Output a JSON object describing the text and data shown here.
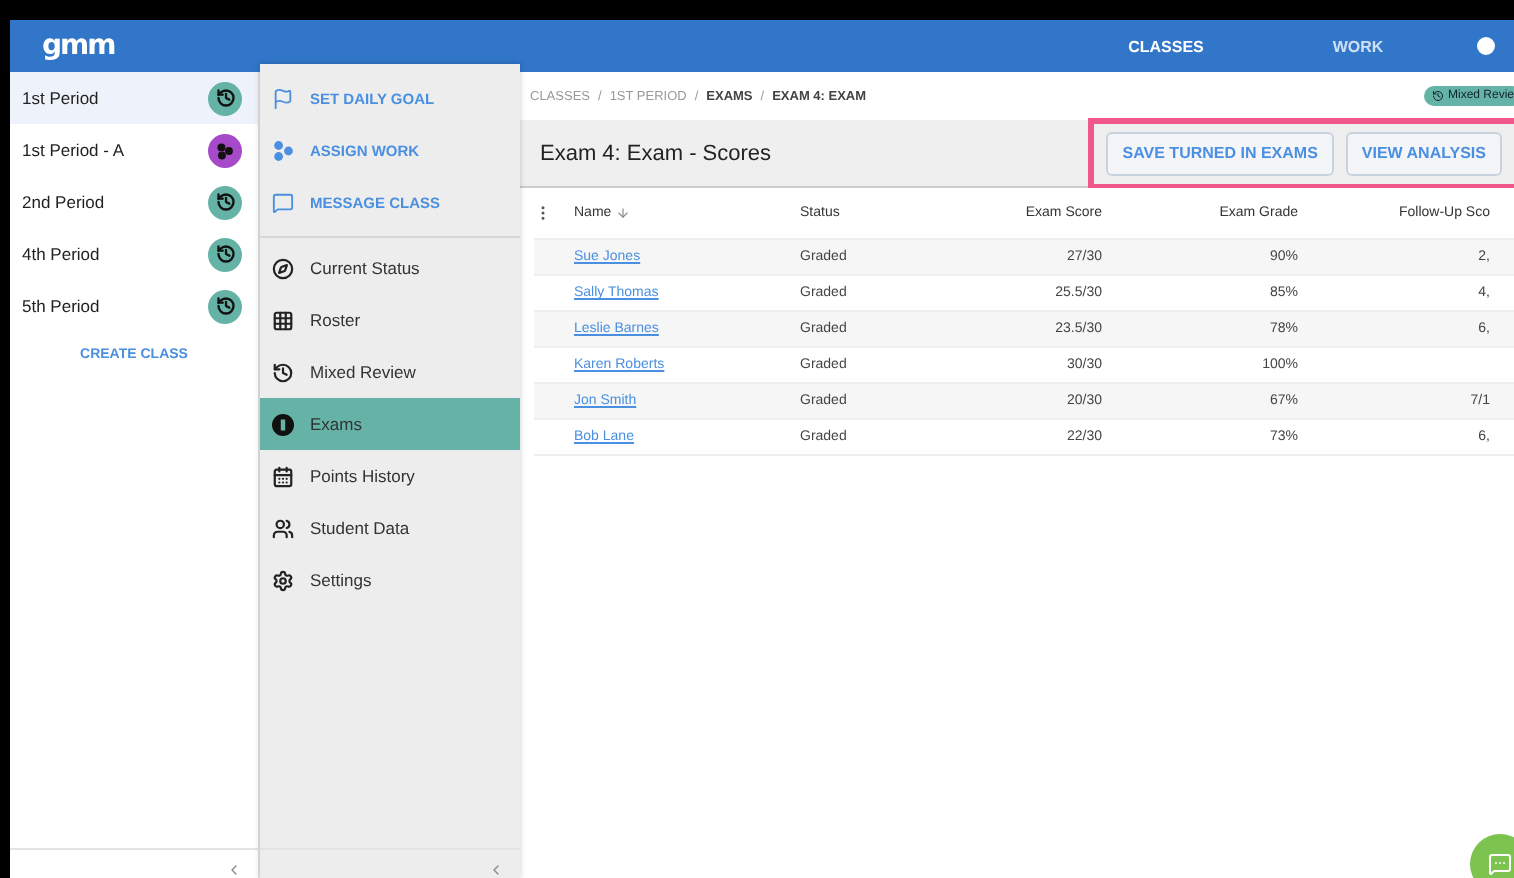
{
  "topbar": {
    "logo": "gmm",
    "nav": [
      {
        "label": "CLASSES",
        "selected": true
      },
      {
        "label": "WORK",
        "selected": false
      }
    ]
  },
  "classes": [
    {
      "name": "1st Period",
      "selected": true,
      "kind": "history"
    },
    {
      "name": "1st Period - A",
      "selected": false,
      "kind": "dots"
    },
    {
      "name": "2nd Period",
      "selected": false,
      "kind": "history"
    },
    {
      "name": "4th Period",
      "selected": false,
      "kind": "history"
    },
    {
      "name": "5th Period",
      "selected": false,
      "kind": "history"
    }
  ],
  "create_class": "CREATE CLASS",
  "class_actions": [
    {
      "label": "SET DAILY GOAL",
      "kind": "flag"
    },
    {
      "label": "ASSIGN WORK",
      "kind": "assign"
    },
    {
      "label": "MESSAGE CLASS",
      "kind": "message"
    }
  ],
  "class_nav": [
    {
      "label": "Current Status",
      "kind": "compass",
      "selected": false
    },
    {
      "label": "Roster",
      "kind": "grid",
      "selected": false
    },
    {
      "label": "Mixed Review",
      "kind": "history",
      "selected": false
    },
    {
      "label": "Exams",
      "kind": "exam",
      "selected": true
    },
    {
      "label": "Points History",
      "kind": "calendar",
      "selected": false
    },
    {
      "label": "Student Data",
      "kind": "people",
      "selected": false
    },
    {
      "label": "Settings",
      "kind": "gear",
      "selected": false
    }
  ],
  "breadcrumb_separator": "/",
  "breadcrumb": [
    {
      "label": "CLASSES",
      "current": false
    },
    {
      "label": "1ST PERIOD",
      "current": false
    },
    {
      "label": "EXAMS",
      "current": true
    },
    {
      "label": "EXAM 4: EXAM",
      "current": true
    }
  ],
  "mixed_review_badge": "Mixed Revie",
  "title": "Exam 4: Exam - Scores",
  "buttons": [
    "SAVE TURNED IN EXAMS",
    "VIEW ANALYSIS"
  ],
  "table": {
    "columns": [
      "Name",
      "Status",
      "Exam Score",
      "Exam Grade",
      "Follow-Up Sco"
    ],
    "rows": [
      [
        "Sue Jones",
        "Graded",
        "27/30",
        "90%",
        "2,"
      ],
      [
        "Sally Thomas",
        "Graded",
        "25.5/30",
        "85%",
        "4,"
      ],
      [
        "Leslie Barnes",
        "Graded",
        "23.5/30",
        "78%",
        "6,"
      ],
      [
        "Karen Roberts",
        "Graded",
        "30/30",
        "100%",
        ""
      ],
      [
        "Jon Smith",
        "Graded",
        "20/30",
        "67%",
        "7/1"
      ],
      [
        "Bob Lane",
        "Graded",
        "22/30",
        "73%",
        "6,"
      ]
    ]
  }
}
